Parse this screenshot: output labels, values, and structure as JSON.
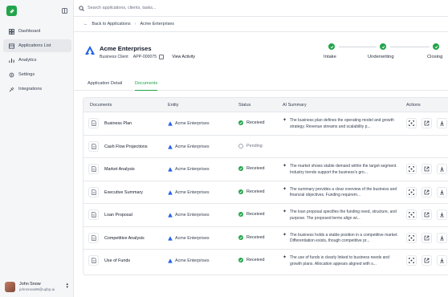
{
  "search": {
    "placeholder": "Search applications, clients, tasks..."
  },
  "sidebar": {
    "items": [
      {
        "label": "Dashboard",
        "icon": "dashboard-icon"
      },
      {
        "label": "Applications List",
        "icon": "list-icon"
      },
      {
        "label": "Analytics",
        "icon": "analytics-icon"
      },
      {
        "label": "Settings",
        "icon": "settings-icon"
      },
      {
        "label": "Integrations",
        "icon": "integrations-icon"
      }
    ],
    "active_index": 1,
    "user": {
      "name": "John Snow",
      "email": "johnsnow89@upbp.ai"
    }
  },
  "breadcrumb": {
    "back": "Back to Applications",
    "separator": "›",
    "current": "Acme Enterprises"
  },
  "client": {
    "name": "Acme Enterprises",
    "type": "Business Client",
    "app_id": "APP-000075",
    "view_activity": "View Activity"
  },
  "steps": [
    {
      "label": "Intake",
      "done": true
    },
    {
      "label": "Underwriting",
      "done": true
    },
    {
      "label": "Closing",
      "done": true
    }
  ],
  "tabs": [
    {
      "label": "Application Detail",
      "active": false
    },
    {
      "label": "Documents",
      "active": true
    }
  ],
  "table": {
    "columns": [
      "Documents",
      "Entity",
      "Status",
      "AI Summary",
      "Actions"
    ],
    "rows": [
      {
        "doc": "Business Plan",
        "entity": "Acme Enterprises",
        "status": "Received",
        "summary": "The business plan defines the operating model and growth strategy. Revenue streams and scalability p..."
      },
      {
        "doc": "Cash Flow Projections",
        "entity": "Acme Enterprises",
        "status": "Pending",
        "summary": ""
      },
      {
        "doc": "Market Analysis",
        "entity": "Acme Enterprises",
        "status": "Received",
        "summary": "The market shows stable demand within the target segment. Industry trends support the business's gro..."
      },
      {
        "doc": "Executive Summary",
        "entity": "Acme Enterprises",
        "status": "Received",
        "summary": "The summary provides a clear overview of the business and financial objectives. Funding requirem..."
      },
      {
        "doc": "Loan Proposal",
        "entity": "Acme Enterprises",
        "status": "Received",
        "summary": "The loan proposal specifies the funding need, structure, and purpose. The proposed terms align wi..."
      },
      {
        "doc": "Competitive Analysis",
        "entity": "Acme Enterprises",
        "status": "Received",
        "summary": "The business holds a stable position in a competitive market. Differentiation exists, though competitive pr..."
      },
      {
        "doc": "Use of Funds",
        "entity": "Acme Enterprises",
        "status": "Received",
        "summary": "The use of funds is clearly linked to business needs and growth plans. Allocation appears aligned with s..."
      }
    ]
  },
  "colors": {
    "accent": "#22a44a",
    "pending": "#9ca3af",
    "entity_icon": "#2563eb"
  }
}
